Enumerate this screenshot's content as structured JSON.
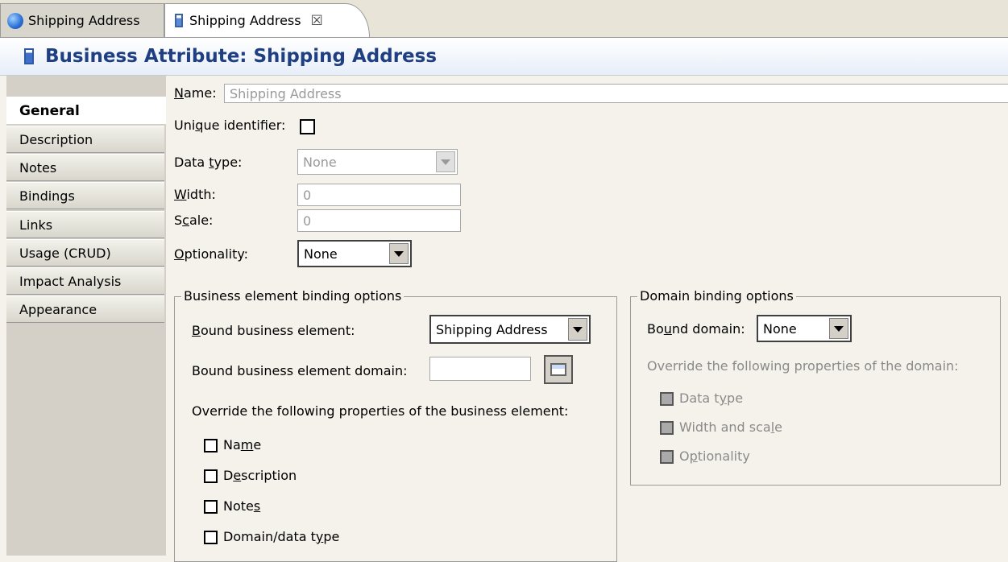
{
  "tabs": [
    {
      "label": "Shipping Address"
    },
    {
      "label": "Shipping Address",
      "close_glyph": "☒"
    }
  ],
  "title": "Business Attribute: Shipping Address",
  "sidebar": {
    "items": [
      {
        "label": "General"
      },
      {
        "label": "Description"
      },
      {
        "label": "Notes"
      },
      {
        "label": "Bindings"
      },
      {
        "label": "Links"
      },
      {
        "label": "Usage (CRUD)"
      },
      {
        "label": "Impact Analysis"
      },
      {
        "label": "Appearance"
      }
    ]
  },
  "form": {
    "name_label_pre": "N",
    "name_label_post": "ame:",
    "name_value": "Shipping Address",
    "unique_label_pre": "Uni",
    "unique_label_mid": "q",
    "unique_label_post": "ue identifier:",
    "datatype_label_pre": "Data ",
    "datatype_label_mid": "t",
    "datatype_label_post": "ype:",
    "datatype_value": "None",
    "width_label_pre": "W",
    "width_label_post": "idth:",
    "width_value": "0",
    "scale_label_pre": "S",
    "scale_label_mid": "c",
    "scale_label_post": "ale:",
    "scale_value": "0",
    "optionality_label_pre": "O",
    "optionality_label_post": "ptionality:",
    "optionality_value": "None"
  },
  "business_group": {
    "title": "Business element binding options",
    "bound_element_label_pre": "B",
    "bound_element_label_post": "ound business element:",
    "bound_element_value": "Shipping Address",
    "bound_domain_label": "Bound business element domain:",
    "bound_domain_value": "",
    "override_text": "Override the following properties of the business element:",
    "checks": [
      {
        "pre": "Na",
        "mid": "m",
        "post": "e"
      },
      {
        "pre": "D",
        "mid": "e",
        "post": "scription"
      },
      {
        "pre": "Note",
        "mid": "s",
        "post": ""
      },
      {
        "pre": "Domain/data t",
        "mid": "y",
        "post": "pe"
      }
    ]
  },
  "domain_group": {
    "title": "Domain binding options",
    "bound_domain_label_pre": "Bo",
    "bound_domain_label_mid": "u",
    "bound_domain_label_post": "nd domain:",
    "bound_domain_value": "None",
    "override_text": "Override the following properties of the domain:",
    "checks": [
      {
        "pre": "Data t",
        "mid": "y",
        "post": "pe"
      },
      {
        "pre": "Width and sca",
        "mid": "l",
        "post": "e"
      },
      {
        "pre": "O",
        "mid": "p",
        "post": "tionality"
      }
    ]
  }
}
